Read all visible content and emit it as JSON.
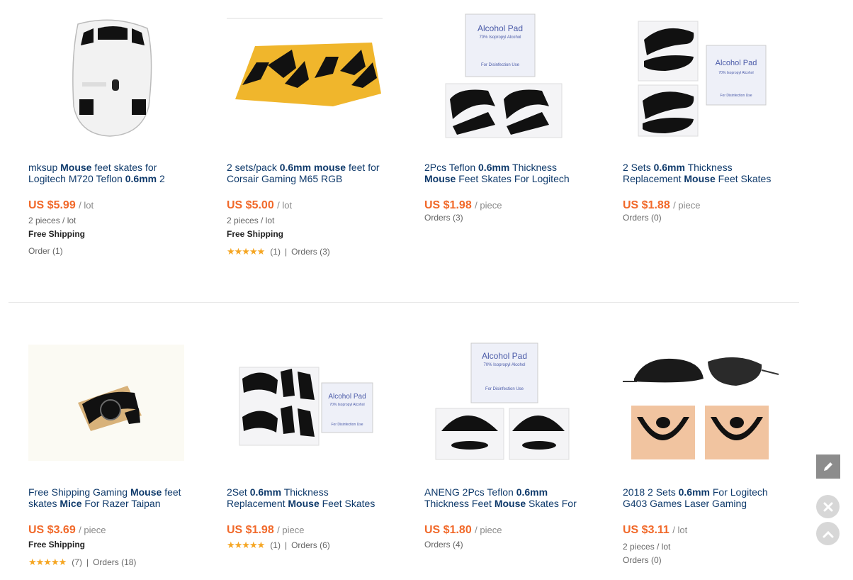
{
  "products": [
    {
      "title_parts": [
        [
          "mksup ",
          false
        ],
        [
          "Mouse",
          true
        ],
        [
          " feet skates for Logitech M720 Teflon ",
          false
        ],
        [
          "0.6mm",
          true
        ],
        [
          " 2",
          false
        ]
      ],
      "price": "US $5.99",
      "unit": "/ lot",
      "pieces": "2 pieces / lot",
      "free_shipping": "Free Shipping",
      "orders": "Order (1)"
    },
    {
      "title_parts": [
        [
          "2 sets/pack ",
          false
        ],
        [
          "0.6mm mouse",
          true
        ],
        [
          " feet for Corsair Gaming M65 RGB",
          false
        ]
      ],
      "price": "US $5.00",
      "unit": "/ lot",
      "pieces": "2 pieces / lot",
      "free_shipping": "Free Shipping",
      "rating_count": "(1)",
      "orders": "Orders (3)"
    },
    {
      "title_parts": [
        [
          "2Pcs Teflon ",
          false
        ],
        [
          "0.6mm",
          true
        ],
        [
          " Thickness ",
          false
        ],
        [
          "Mouse",
          true
        ],
        [
          " Feet Skates For Logitech",
          false
        ]
      ],
      "price": "US $1.98",
      "unit": "/ piece",
      "orders": "Orders (3)"
    },
    {
      "title_parts": [
        [
          "2 Sets ",
          false
        ],
        [
          "0.6mm",
          true
        ],
        [
          " Thickness Replacement ",
          false
        ],
        [
          "Mouse",
          true
        ],
        [
          " Feet Skates",
          false
        ]
      ],
      "price": "US $1.88",
      "unit": "/ piece",
      "orders": "Orders (0)"
    },
    {
      "title_parts": [
        [
          "Free Shipping Gaming ",
          false
        ],
        [
          "Mouse",
          true
        ],
        [
          " feet skates ",
          false
        ],
        [
          "Mice",
          true
        ],
        [
          " For Razer Taipan",
          false
        ]
      ],
      "price": "US $3.69",
      "unit": "/ piece",
      "free_shipping": "Free Shipping",
      "rating_count": "(7)",
      "orders": "Orders (18)"
    },
    {
      "title_parts": [
        [
          "2Set ",
          false
        ],
        [
          "0.6mm",
          true
        ],
        [
          " Thickness Replacement ",
          false
        ],
        [
          "Mouse",
          true
        ],
        [
          " Feet Skates",
          false
        ]
      ],
      "price": "US $1.98",
      "unit": "/ piece",
      "rating_count": "(1)",
      "orders": "Orders (6)"
    },
    {
      "title_parts": [
        [
          "ANENG 2Pcs Teflon ",
          false
        ],
        [
          "0.6mm",
          true
        ],
        [
          " Thickness Feet ",
          false
        ],
        [
          "Mouse",
          true
        ],
        [
          " Skates For",
          false
        ]
      ],
      "price": "US $1.80",
      "unit": "/ piece",
      "orders": "Orders (4)"
    },
    {
      "title_parts": [
        [
          "2018 2 Sets ",
          false
        ],
        [
          "0.6mm",
          true
        ],
        [
          " For Logitech G403 Games Laser Gaming",
          false
        ]
      ],
      "price": "US $3.11",
      "unit": "/ lot",
      "pieces": "2 pieces / lot",
      "orders": "Orders (0)"
    }
  ],
  "image_labels": {
    "alcohol_pad": "Alcohol Pad",
    "alcohol_sub": "70% Isopropyl Alcohol",
    "disinfection": "For Disinfection Use"
  },
  "stars": "★★★★★",
  "separator": "|",
  "widgets": {
    "edit_icon": "pencil-icon",
    "close_icon": "close-icon",
    "up_icon": "chevron-up-icon"
  },
  "colors": {
    "price": "#f1692a",
    "title": "#0f3a6b",
    "stars": "#f5a623"
  }
}
